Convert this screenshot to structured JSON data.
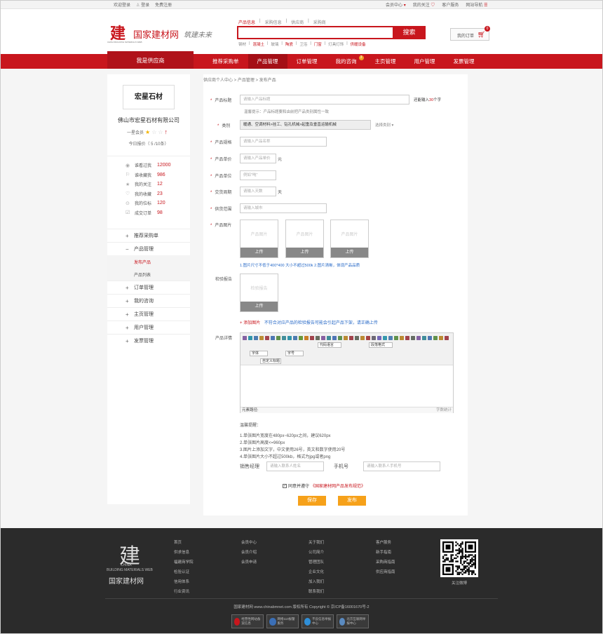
{
  "topbar": {
    "welcome": "欢迎登录",
    "login": "登录",
    "register": "免费注册",
    "member_center": "会员中心",
    "my_follow": "我的关注",
    "service": "客户服务",
    "site_nav": "网站导航"
  },
  "header": {
    "logo_name": "国家建材网",
    "logo_sub": "CHINA BUILDING MATERIALS WEB",
    "slogan": "筑建未来",
    "search_tabs": [
      "产品信息",
      "采购信息",
      "供应商",
      "采购商"
    ],
    "search_button": "搜索",
    "hot_words": [
      "钢材",
      "混凝土",
      "玻璃",
      "陶瓷",
      "卫浴",
      "门窗",
      "灯具灯饰",
      "供暖设备"
    ],
    "cart_label": "我的订单",
    "cart_count": "0"
  },
  "nav": {
    "home": "我是供应商",
    "items": [
      "推荐采购单",
      "产品管理",
      "订单管理",
      "我的咨询",
      "主页管理",
      "用户管理",
      "发票管理"
    ],
    "consult_badge": "3"
  },
  "sidebar": {
    "company_logo_text": "宏星石材",
    "company_name": "佛山市宏星石材有限公司",
    "member_level": "一星会员",
    "today_quote": "今日报价（ 5 /10条）",
    "stats": [
      {
        "icon": "eye-icon",
        "label": "谁看过我",
        "value": "12000"
      },
      {
        "icon": "bookmark-icon",
        "label": "谁收藏我",
        "value": "986"
      },
      {
        "icon": "star-icon",
        "label": "我的关注",
        "value": "12"
      },
      {
        "icon": "heart-icon",
        "label": "我的收藏",
        "value": "23"
      },
      {
        "icon": "location-icon",
        "label": "我的位标",
        "value": "120"
      },
      {
        "icon": "checklist-icon",
        "label": "成交订单",
        "value": "98"
      }
    ],
    "menu": {
      "recommend": "推荐采购单",
      "product_mgmt": "产品管理",
      "publish": "发布产品",
      "product_list": "产品列表",
      "order": "订单管理",
      "consult": "我的咨询",
      "homepage": "主页管理",
      "user": "用户管理",
      "invoice": "发票管理"
    }
  },
  "form": {
    "breadcrumb": "供应商个人中心 > 产品管理 > 发布产品",
    "title_label": "产品标题",
    "title_placeholder": "请输入产品标题",
    "title_limit_pre": "还能输入",
    "title_limit_num": "30",
    "title_limit_post": "个字",
    "title_tip": "温馨提示：产品标题要和由前把产品类别属性一致",
    "category_label": "类别",
    "category_value": "暖通、空调材料>挂工、钻孔机械>起重及垂直运输机械",
    "category_select": "选择类别",
    "spec_label": "产品规格",
    "spec_placeholder": "请输入产品名称",
    "price_label": "产品单价",
    "price_placeholder": "请输入产品单价",
    "price_unit": "元",
    "unit_label": "产品单位",
    "unit_placeholder": "例如\"吨\"",
    "delivery_label": "交货周期",
    "delivery_placeholder": "请输入天数",
    "delivery_unit": "天",
    "range_label": "供货范围",
    "range_placeholder": "请输入城市",
    "image_label": "产品图片",
    "image_placeholder": "产品图片",
    "upload": "上传",
    "image_note": "1.图片尺寸不低于400*400 大小不超过500k  2.图片清晰，体现产品品质",
    "report_label": "检验报告",
    "report_placeholder": "检验报告",
    "add_image": "添加图片",
    "add_image_note": "不符合对应产品的检验报告可能会引起产品下架，请正确上传",
    "detail_label": "产品详情",
    "editor_font": "代码语言",
    "editor_para": "段落格式",
    "editor_family": "字体",
    "editor_size": "字号",
    "editor_custom": "自定义标题",
    "editor_path": "元素路径:",
    "editor_wordcount": "字数统计",
    "tips_title": "温馨提醒：",
    "tips": [
      "1.单张图片宽度在480px~620px之间，建议620px",
      "2.单张图片高度<=960px",
      "3.图片上添加文字，中文使用26号，英文和数字使用20号",
      "4.单张图片大小不超过500kb，格式为jpg或者png"
    ],
    "sales_label": "销售经理",
    "sales_placeholder": "请输入联系人姓名",
    "phone_label": "手机号",
    "phone_placeholder": "请输入联系人手机号",
    "agree_text": "同意并遵守",
    "agree_link": "《国家建材网产品发布规范》",
    "save": "保存",
    "publish": "发布"
  },
  "footer": {
    "logo_en_1": "CHINA",
    "logo_en_2": "BUILDING MATERIALS WEB",
    "logo_cn": "国家建材网",
    "col1": [
      "首页",
      "供求信息",
      "福建商学院",
      "检验认证",
      "信用体系",
      "行业资讯"
    ],
    "col2": [
      "会员中心",
      "会员介绍",
      "会员申请"
    ],
    "col3": [
      "关于我们",
      "公司简介",
      "管理团队",
      "企业文化",
      "加入我们",
      "联系我们"
    ],
    "col4": [
      "客户服务",
      "新手指南",
      "采购商指南",
      "供应商指南"
    ],
    "qr_caption": "关注微博",
    "copyright": "国家建材网 www.chinabmnet.com 版权所有 Copyright © 京ICP备16001670号-2",
    "badges": [
      "经营性网站备案信息",
      "网络110报警服务",
      "不良信息举报中心",
      "北京互联网举报中心"
    ]
  },
  "colors": {
    "brand_red": "#c8161d",
    "accent_orange": "#f6a11a"
  }
}
